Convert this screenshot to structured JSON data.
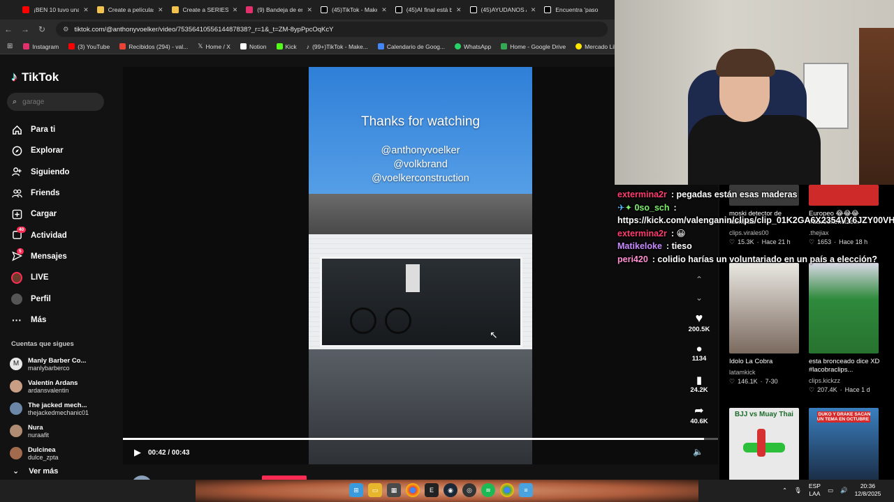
{
  "browser": {
    "tabs": [
      {
        "label": "¡BEN 10 tuvo una",
        "color": "#ff0000"
      },
      {
        "label": "Create a películas",
        "color": "#f2c14e"
      },
      {
        "label": "Create a SERIES A",
        "color": "#f2c14e"
      },
      {
        "label": "(9) Bandeja de en",
        "color": "#e1306c"
      },
      {
        "label": "(45)TikTok - Make",
        "color": "#ffffff"
      },
      {
        "label": "(45)AI final está b",
        "color": "#ffffff"
      },
      {
        "label": "(45)AYUDANOS A",
        "color": "#ffffff"
      },
      {
        "label": "Encuentra 'paso",
        "color": "#ffffff"
      }
    ],
    "url": "tiktok.com/@anthonyvoelker/video/7535641055614487838?_r=1&_t=ZM-8ypPpcOqKcY",
    "bookmarks": [
      {
        "label": "Instagram",
        "color": "#e1306c"
      },
      {
        "label": "(3) YouTube",
        "color": "#ff0000"
      },
      {
        "label": "Recibidos (294) - val...",
        "color": "#ea4335"
      },
      {
        "label": "Home / X",
        "color": "#ffffff"
      },
      {
        "label": "Notion",
        "color": "#ffffff"
      },
      {
        "label": "Kick",
        "color": "#53fc18"
      },
      {
        "label": "(99+)TikTok - Make...",
        "color": "#ffffff"
      },
      {
        "label": "Calendario de Goog...",
        "color": "#4285f4"
      },
      {
        "label": "WhatsApp",
        "color": "#25d366"
      },
      {
        "label": "Home - Google Drive",
        "color": "#34a853"
      },
      {
        "label": "Mercado Libre Arge...",
        "color": "#ffe600"
      }
    ]
  },
  "tiktok": {
    "logo": "TikTok",
    "search_placeholder": "garage",
    "nav": [
      {
        "label": "Para ti",
        "icon": "home-icon"
      },
      {
        "label": "Explorar",
        "icon": "compass-icon"
      },
      {
        "label": "Siguiendo",
        "icon": "following-icon"
      },
      {
        "label": "Friends",
        "icon": "friends-icon"
      },
      {
        "label": "Cargar",
        "icon": "upload-icon"
      },
      {
        "label": "Actividad",
        "icon": "activity-icon",
        "badge": "40"
      },
      {
        "label": "Mensajes",
        "icon": "messages-icon",
        "badge": "5"
      },
      {
        "label": "LIVE",
        "icon": "live-icon"
      },
      {
        "label": "Perfil",
        "icon": "profile-icon"
      },
      {
        "label": "Más",
        "icon": "more-icon"
      }
    ],
    "following_title": "Cuentas que sigues",
    "following": [
      {
        "name": "Manly Barber Co...",
        "user": "manlybarberco",
        "color": "#e8e8e8"
      },
      {
        "name": "Valentín Ardans",
        "user": "ardansvalentin",
        "color": "#c89f84"
      },
      {
        "name": "The jacked mech...",
        "user": "thejackedmechanic01",
        "color": "#6d87a8"
      },
      {
        "name": "Nura",
        "user": "nuraafit",
        "color": "#b08c72"
      },
      {
        "name": "Dulcinea",
        "user": "dulce_zpta",
        "color": "#a36b4e"
      }
    ],
    "ver_mas": "Ver más",
    "video": {
      "title_text": "Thanks for watching",
      "handles": [
        "@anthonyvoelker",
        "@volkbrand",
        "@voelkerconstruction"
      ],
      "time": "00:42 / 00:43",
      "progress": 0.977,
      "likes": "200.5K",
      "comments": "1134",
      "saves": "24.2K",
      "shares": "40.6K",
      "author": "anthonyvoelker"
    }
  },
  "chat": [
    {
      "user": "extermina2r",
      "color": "#ff3c6e",
      "text": "pegadas están esas maderas"
    },
    {
      "user": "0so_sch",
      "color": "#7cf06b",
      "text": ""
    },
    {
      "user": "",
      "color": "#ffffff",
      "text": "https://kick.com/valenganin/clips/clip_01K2GA6X2354VY6JZY00VH"
    },
    {
      "user": "extermina2r",
      "color": "#ff3c6e",
      "text": "😀"
    },
    {
      "user": "Matikeloke",
      "color": "#c98bff",
      "text": "tieso"
    },
    {
      "user": "peri420",
      "color": "#ff8fd1",
      "text": "colidio harías un voluntariado en un país a elección?"
    }
  ],
  "clips": [
    {
      "title": "moski detector de mentiras",
      "channel": "clips.virales00",
      "likes": "15.3K",
      "age": "Hace 21 h",
      "color": "#3a3a3a"
    },
    {
      "title": "Europeo 😂😂😂 #davooxeneize...",
      "channel": ".thejiax",
      "likes": "1653",
      "age": "Hace 18 h",
      "color": "#cf2a2a"
    },
    {
      "title": "Idolo La Cobra",
      "channel": "latamkick",
      "likes": "146.1K",
      "age": "7-30",
      "color": "#7b6a5e"
    },
    {
      "title": "esta bronceado dice XD #lacobraclips...",
      "channel": "clips.kickzz",
      "likes": "207.4K",
      "age": "Hace 1 d",
      "color": "#2f8a3c"
    },
    {
      "title": "BJJ vs Muay Thai",
      "channel": "",
      "likes": "",
      "age": "",
      "color": "#e9e9e9"
    },
    {
      "title": "DUKO Y DRAKE SACAN UN TEMA EN OCTUBRE",
      "channel": "",
      "likes": "",
      "age": "",
      "color": "#3a7fbf"
    }
  ],
  "taskbar": {
    "lang": "ESP",
    "lang2": "LAA",
    "time": "20:36",
    "date": "12/8/2025"
  }
}
